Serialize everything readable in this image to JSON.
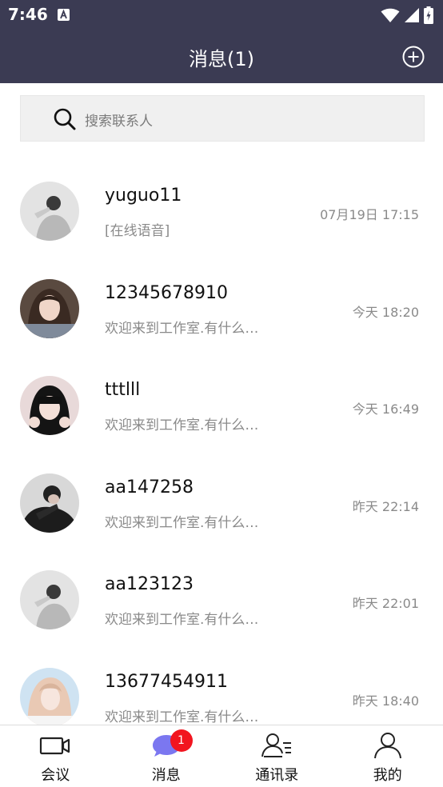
{
  "status_bar": {
    "time": "7:46"
  },
  "header": {
    "title": "消息(1)"
  },
  "search": {
    "placeholder": "搜索联系人"
  },
  "conversations": [
    {
      "name": "yuguo11",
      "preview": "[在线语音]",
      "time": "07月19日 17:15",
      "avatar": "avatar-grey-man"
    },
    {
      "name": "12345678910",
      "preview": "欢迎来到工作室.有什么…",
      "time": "今天 18:20",
      "avatar": "avatar-woman-long-hair"
    },
    {
      "name": "tttlll",
      "preview": "欢迎来到工作室.有什么…",
      "time": "今天 16:49",
      "avatar": "avatar-woman-bangs"
    },
    {
      "name": "aa147258",
      "preview": "欢迎来到工作室.有什么…",
      "time": "昨天 22:14",
      "avatar": "avatar-man-dark"
    },
    {
      "name": "aa123123",
      "preview": "欢迎来到工作室.有什么…",
      "time": "昨天 22:01",
      "avatar": "avatar-grey-man"
    },
    {
      "name": "13677454911",
      "preview": "欢迎来到工作室.有什么…",
      "time": "昨天 18:40",
      "avatar": "avatar-woman-light"
    }
  ],
  "bottom_nav": [
    {
      "label": "会议",
      "icon": "video-camera-icon"
    },
    {
      "label": "消息",
      "icon": "chat-bubble-icon",
      "badge": "1"
    },
    {
      "label": "通讯录",
      "icon": "contacts-icon"
    },
    {
      "label": "我的",
      "icon": "profile-icon"
    }
  ],
  "colors": {
    "header_bg": "#3b3b53",
    "badge_red": "#f2151f",
    "chat_icon_purple": "#7b77f0",
    "search_bg": "#f0f0f0"
  }
}
